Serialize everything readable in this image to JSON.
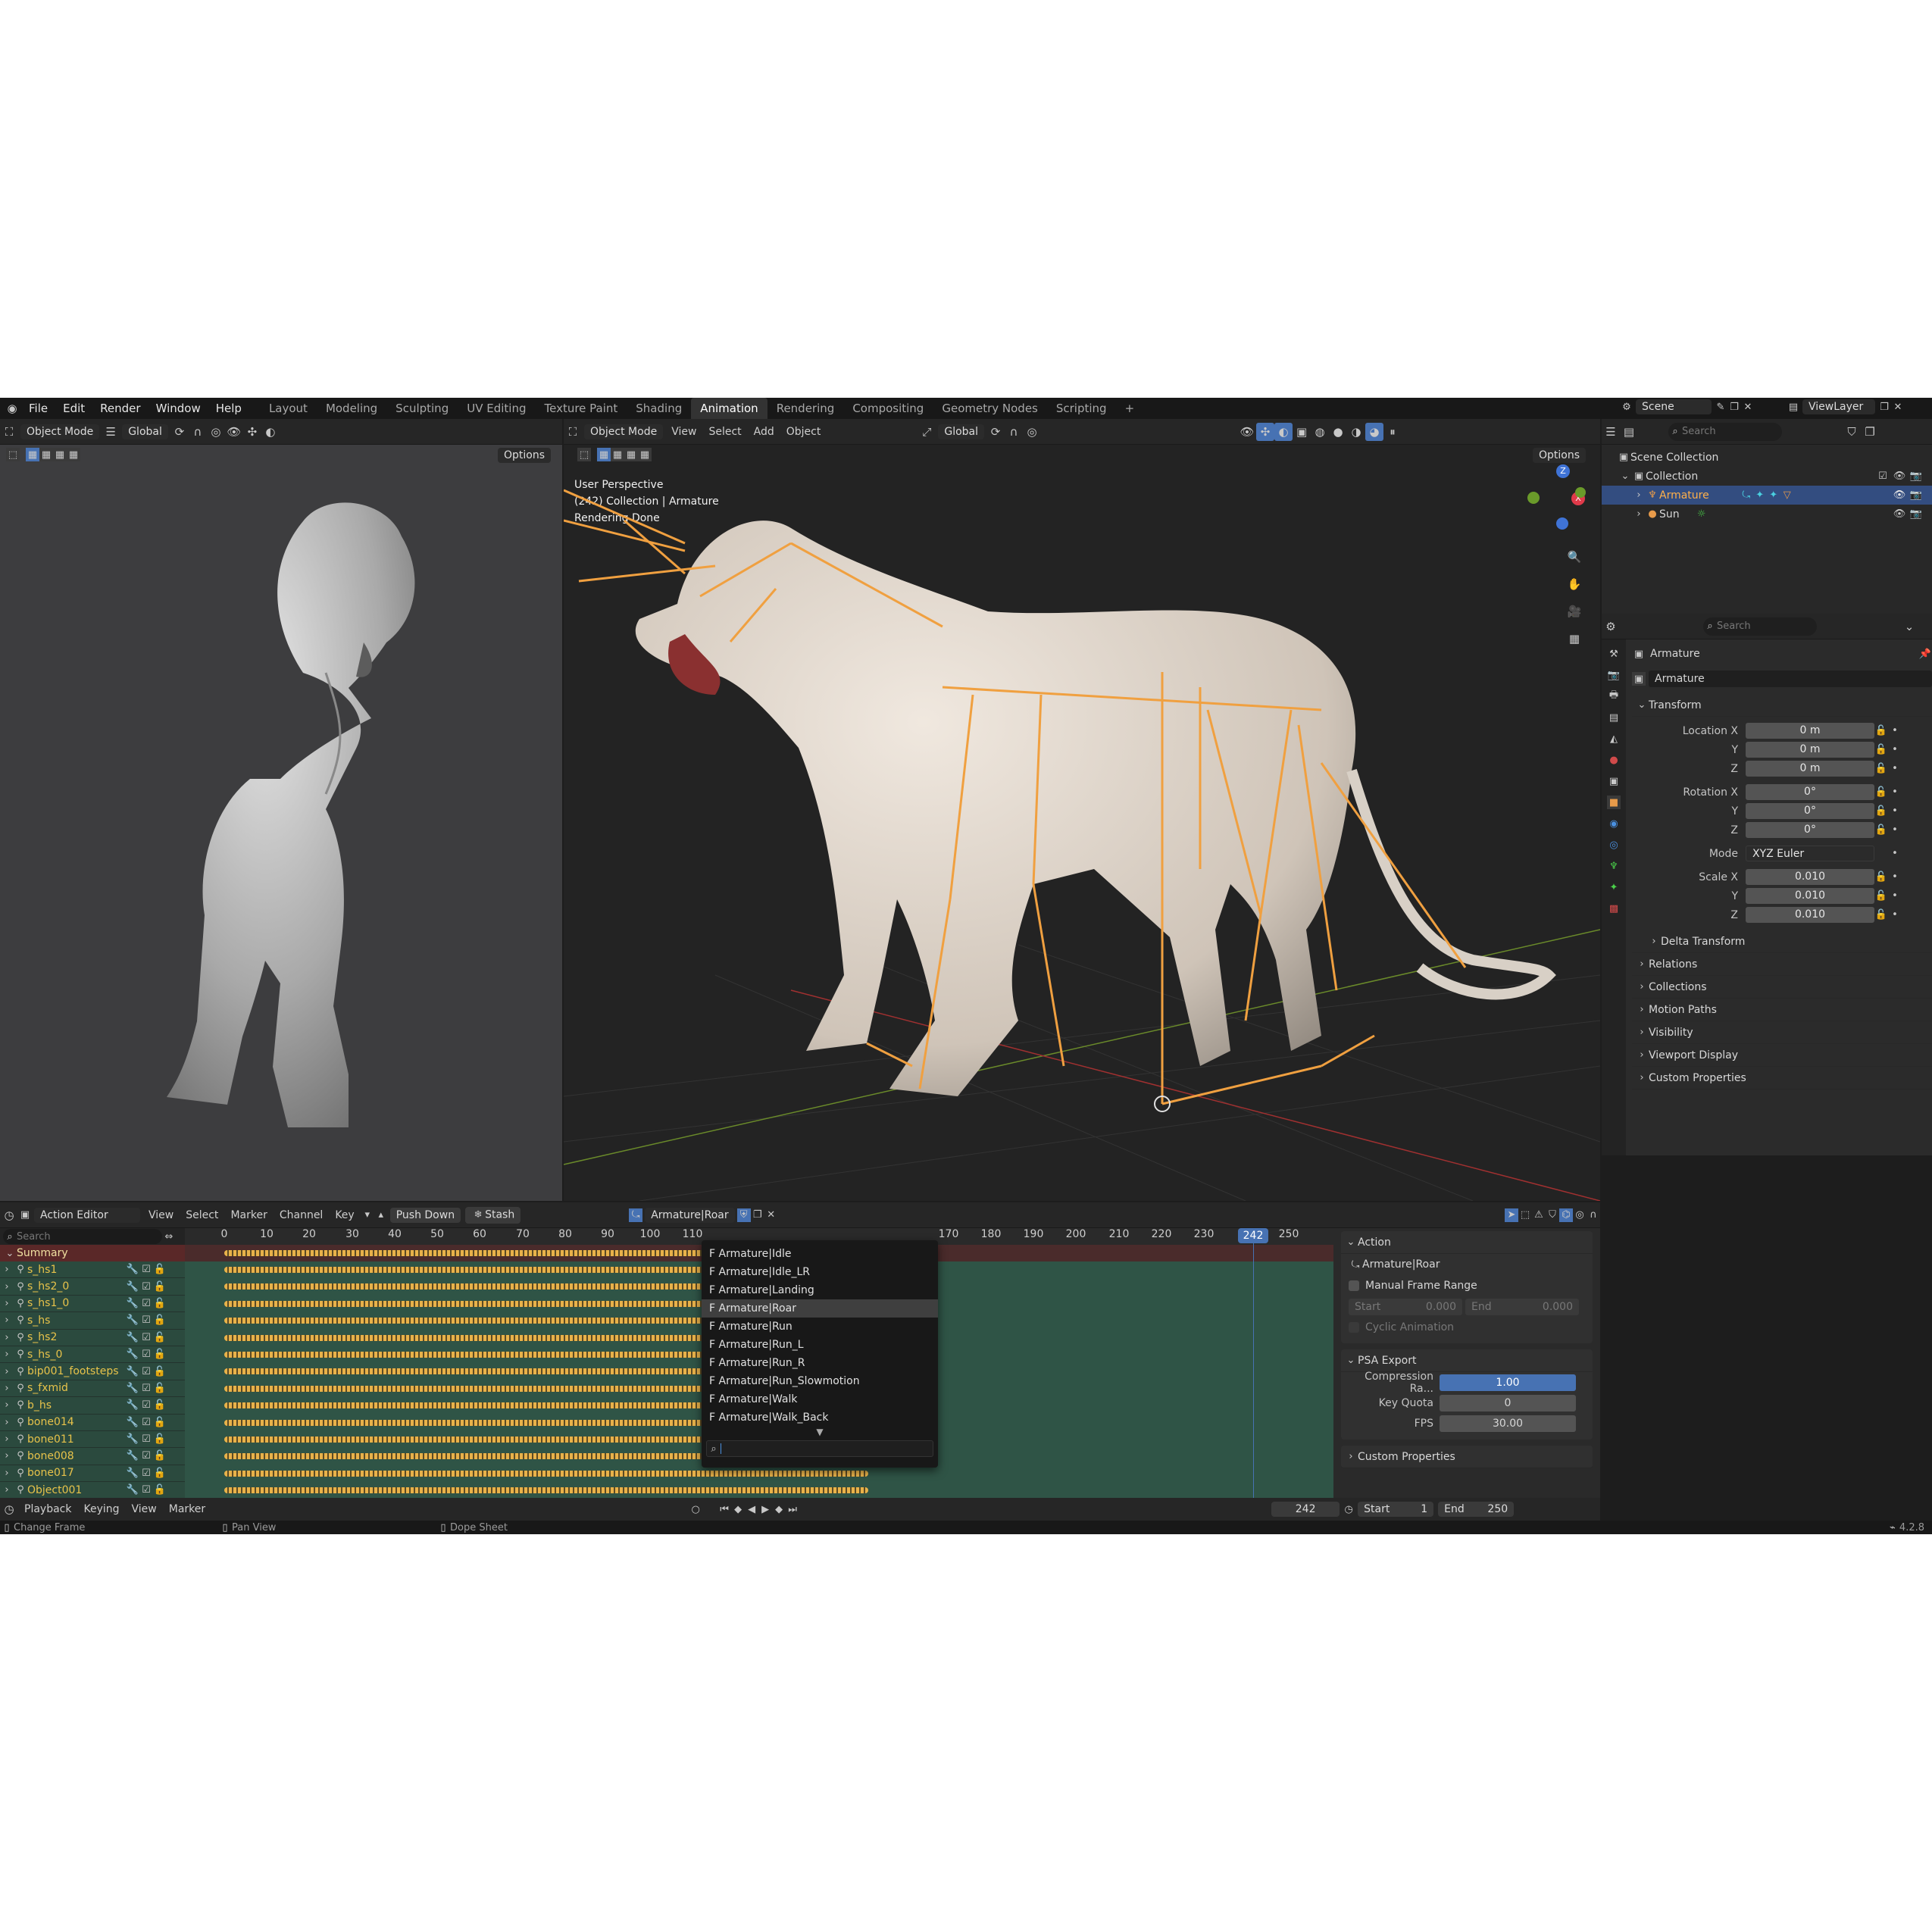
{
  "menu": [
    "File",
    "Edit",
    "Render",
    "Window",
    "Help"
  ],
  "workspaces": [
    "Layout",
    "Modeling",
    "Sculpting",
    "UV Editing",
    "Texture Paint",
    "Shading",
    "Animation",
    "Rendering",
    "Compositing",
    "Geometry Nodes",
    "Scripting"
  ],
  "active_workspace": "Animation",
  "scene": {
    "name": "Scene",
    "view_layer": "ViewLayer"
  },
  "left_view": {
    "mode": "Object Mode",
    "orientation": "Global",
    "options": "Options"
  },
  "main_view": {
    "mode": "Object Mode",
    "menus": [
      "View",
      "Select",
      "Add",
      "Object"
    ],
    "orientation": "Global",
    "options": "Options",
    "overlay_lines": [
      "User Perspective",
      "(242) Collection | Armature",
      "Rendering Done"
    ]
  },
  "outliner": {
    "search_placeholder": "Search",
    "items": [
      {
        "label": "Scene Collection"
      },
      {
        "label": "Collection"
      },
      {
        "label": "Armature"
      },
      {
        "label": "Sun"
      }
    ]
  },
  "properties": {
    "search_placeholder": "Search",
    "object_name": "Armature",
    "data_name": "Armature",
    "transform_title": "Transform",
    "location": {
      "label": "Location X",
      "x": "0 m",
      "y": "0 m",
      "z": "0 m"
    },
    "rotation": {
      "label": "Rotation X",
      "x": "0°",
      "y": "0°",
      "z": "0°"
    },
    "mode": {
      "label": "Mode",
      "value": "XYZ Euler"
    },
    "scale": {
      "label": "Scale X",
      "x": "0.010",
      "y": "0.010",
      "z": "0.010"
    },
    "axis_y": "Y",
    "axis_z": "Z",
    "delta": "Delta Transform",
    "sections": [
      "Relations",
      "Collections",
      "Motion Paths",
      "Visibility",
      "Viewport Display",
      "Custom Properties"
    ]
  },
  "action_editor": {
    "editor": "Action Editor",
    "menus": [
      "View",
      "Select",
      "Marker",
      "Channel",
      "Key"
    ],
    "push_down": "Push Down",
    "stash": "Stash",
    "action_name": "Armature|Roar",
    "search_placeholder": "Search",
    "ticks": [
      "0",
      "10",
      "20",
      "30",
      "40",
      "50",
      "60",
      "70",
      "80",
      "90",
      "100",
      "110",
      "170",
      "180",
      "190",
      "200",
      "210",
      "220",
      "230",
      "242",
      "250"
    ],
    "current_frame": "242",
    "summary": "Summary",
    "channels": [
      "s_hs1",
      "s_hs2_0",
      "s_hs1_0",
      "s_hs",
      "s_hs2",
      "s_hs_0",
      "bip001_footsteps",
      "s_fxmid",
      "b_hs",
      "bone014",
      "bone011",
      "bone008",
      "bone017",
      "Object001"
    ],
    "dropdown": [
      "F Armature|Idle",
      "F Armature|Idle_LR",
      "F Armature|Landing",
      "F Armature|Roar",
      "F Armature|Run",
      "F Armature|Run_L",
      "F Armature|Run_R",
      "F Armature|Run_Slowmotion",
      "F Armature|Walk",
      "F Armature|Walk_Back"
    ],
    "dropdown_selected": "F Armature|Roar"
  },
  "side_panel": {
    "action_title": "Action",
    "action_name": "Armature|Roar",
    "manual_range": "Manual Frame Range",
    "start_label": "Start",
    "start_val": "0.000",
    "end_label": "End",
    "end_val": "0.000",
    "cyclic": "Cyclic Animation",
    "psa_title": "PSA Export",
    "compression_label": "Compression Ra...",
    "compression_val": "1.00",
    "key_quota_label": "Key Quota",
    "key_quota_val": "0",
    "fps_label": "FPS",
    "fps_val": "30.00",
    "custom_props": "Custom Properties"
  },
  "timeline": {
    "menus": [
      "Playback",
      "Keying",
      "View",
      "Marker"
    ],
    "frame": "242",
    "start_label": "Start",
    "start": "1",
    "end_label": "End",
    "end": "250"
  },
  "status": {
    "items": [
      "Change Frame",
      "Pan View",
      "Dope Sheet"
    ],
    "version": "4.2.8"
  },
  "colors": {
    "accent": "#4772b3",
    "keyframe": "#e8b24a",
    "bone": "#f0a040",
    "channel_bg": "#2b4a3e"
  }
}
